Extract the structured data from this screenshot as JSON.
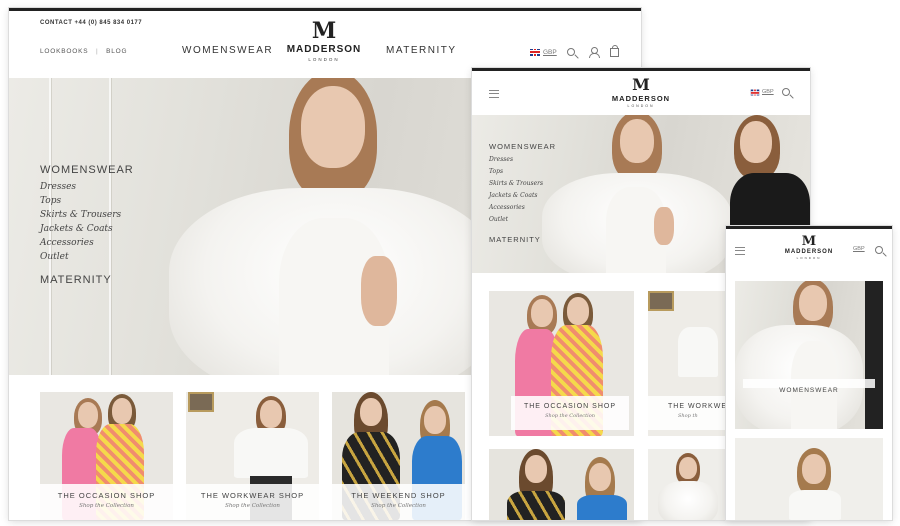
{
  "desktop": {
    "contact": "CONTACT +44 (0) 845 834 0177",
    "links": [
      "LOOKBOOKS",
      "BLOG"
    ],
    "link_separator": "|",
    "nav": [
      "WOMENSWEAR",
      "MATERNITY"
    ],
    "logo": {
      "mark": "M",
      "name": "MADDERSON",
      "sub": "LONDON"
    },
    "currency": "GBP",
    "icons": [
      "flag-uk-icon",
      "search-icon",
      "user-icon",
      "bag-icon"
    ],
    "hero_menu": {
      "title": "WOMENSWEAR",
      "items": [
        "Dresses",
        "Tops",
        "Skirts & Trousers",
        "Jackets & Coats",
        "Accessories",
        "Outlet"
      ],
      "second_title": "MATERNITY"
    },
    "tiles": [
      {
        "title": "THE OCCASION SHOP",
        "sub": "Shop the Collection"
      },
      {
        "title": "THE WORKWEAR SHOP",
        "sub": "Shop the Collection"
      },
      {
        "title": "THE WEEKEND SHOP",
        "sub": "Shop the Collection"
      }
    ]
  },
  "tablet": {
    "logo": {
      "mark": "M",
      "name": "MADDERSON",
      "sub": "LONDON"
    },
    "currency": "GBP",
    "hero_menu": {
      "title": "WOMENSWEAR",
      "items": [
        "Dresses",
        "Tops",
        "Skirts & Trousers",
        "Jackets & Coats",
        "Accessories",
        "Outlet"
      ],
      "second_title": "MATERNITY"
    },
    "tiles": [
      {
        "title": "THE OCCASION SHOP",
        "sub": "Shop the Collection"
      },
      {
        "title": "THE WORKWE",
        "sub": "Shop th"
      }
    ]
  },
  "mobile": {
    "logo": {
      "mark": "M",
      "name": "MADDERSON",
      "sub": "LONDON"
    },
    "currency": "GBP",
    "hero_label": "WOMENSWEAR"
  },
  "colors": {
    "topbar": "#222222",
    "text": "#444444",
    "pink": "#f07aa3",
    "blue": "#2d7ccc"
  }
}
